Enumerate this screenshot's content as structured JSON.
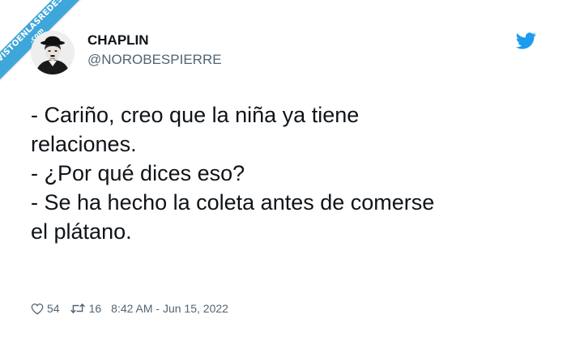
{
  "watermark": {
    "line1": "VISTOENLASREDES",
    "line2": ".com",
    "color": "#3ea6d9"
  },
  "tweet": {
    "author_name": "CHAPLIN",
    "author_handle": "@NOROBESPIERRE",
    "platform_icon": "twitter-bird-icon",
    "text_lines": [
      "- Cariño, creo que la niña ya tiene",
      "relaciones.",
      "- ¿Por qué dices eso?",
      "- Se ha hecho la coleta antes de comerse",
      "el plátano."
    ],
    "likes": "54",
    "retweets": "16",
    "timestamp": "8:42 AM - Jun 15, 2022"
  },
  "colors": {
    "text": "#0f1419",
    "secondary": "#536471",
    "twitter_blue": "#1d9bf0"
  }
}
